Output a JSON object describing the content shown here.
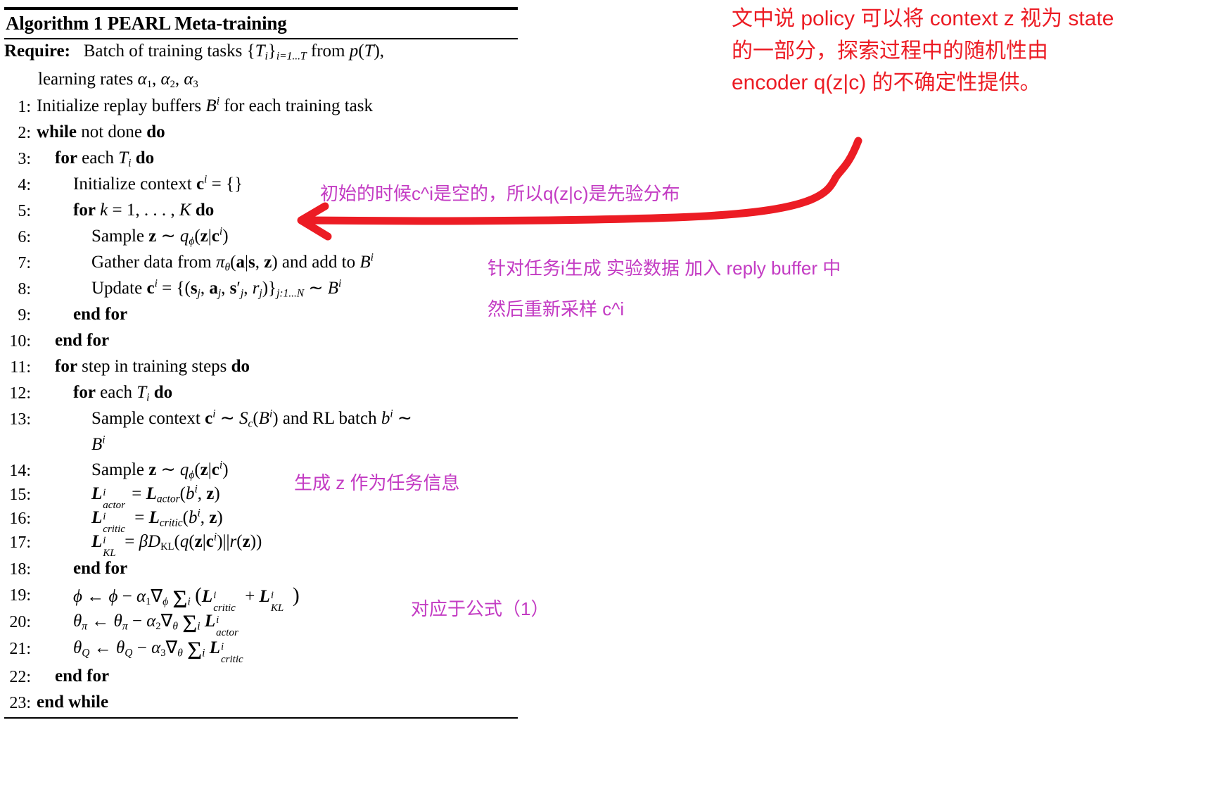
{
  "algorithm": {
    "title": "Algorithm 1 PEARL Meta-training",
    "require_label": "Require:",
    "require_line1": "Batch of training tasks {T_i}_{i=1...T} from p(T),",
    "require_line2": "learning rates α₁, α₂, α₃",
    "lines": [
      {
        "num": "1:",
        "indent": 0,
        "text": "Initialize replay buffers B^i for each training task"
      },
      {
        "num": "2:",
        "indent": 0,
        "text": "while not done do"
      },
      {
        "num": "3:",
        "indent": 1,
        "text": "for each T_i do"
      },
      {
        "num": "4:",
        "indent": 2,
        "text": "Initialize context c^i = {}"
      },
      {
        "num": "5:",
        "indent": 2,
        "text": "for k = 1, ..., K do"
      },
      {
        "num": "6:",
        "indent": 3,
        "text": "Sample z ~ q_ϕ(z|c^i)"
      },
      {
        "num": "7:",
        "indent": 3,
        "text": "Gather data from π_θ(a|s, z) and add to B^i"
      },
      {
        "num": "8:",
        "indent": 3,
        "text": "Update c^i = {(s_j, a_j, s'_j, r_j)}_{j:1...N} ~ B^i"
      },
      {
        "num": "9:",
        "indent": 2,
        "text": "end for"
      },
      {
        "num": "10:",
        "indent": 1,
        "text": "end for"
      },
      {
        "num": "11:",
        "indent": 1,
        "text": "for step in training steps do"
      },
      {
        "num": "12:",
        "indent": 2,
        "text": "for each T_i do"
      },
      {
        "num": "13:",
        "indent": 3,
        "text": "Sample context c^i ~ S_c(B^i) and RL batch b^i ~"
      },
      {
        "num": "",
        "indent": 3,
        "text": "B^i"
      },
      {
        "num": "14:",
        "indent": 3,
        "text": "Sample z ~ q_ϕ(z|c^i)"
      },
      {
        "num": "15:",
        "indent": 3,
        "text": "L^i_actor = L_actor(b^i, z)"
      },
      {
        "num": "16:",
        "indent": 3,
        "text": "L^i_critic = L_critic(b^i, z)"
      },
      {
        "num": "17:",
        "indent": 3,
        "text": "L^i_KL = β D_KL(q(z|c^i)||r(z))"
      },
      {
        "num": "18:",
        "indent": 2,
        "text": "end for"
      },
      {
        "num": "19:",
        "indent": 2,
        "text": "ϕ ← ϕ − α₁ ∇_ϕ Σ_i (L^i_critic + L^i_KL)"
      },
      {
        "num": "20:",
        "indent": 2,
        "text": "θ_π ← θ_π − α₂ ∇_θ Σ_i L^i_actor"
      },
      {
        "num": "21:",
        "indent": 2,
        "text": "θ_Q ← θ_Q − α₃ ∇_θ Σ_i L^i_critic"
      },
      {
        "num": "22:",
        "indent": 1,
        "text": "end for"
      },
      {
        "num": "23:",
        "indent": 0,
        "text": "end while"
      }
    ]
  },
  "annotations": {
    "red_top": "文中说 policy 可以将 context z 视为 state 的一部分，探索过程中的随机性由 encoder q(z|c) 的不确定性提供。",
    "line4": "初始的时候c^i是空的，所以q(z|c)是先验分布",
    "line7": "针对任务i生成 实验数据 加入 reply buffer 中",
    "line8": "然后重新采样 c^i",
    "line14": "生成 z 作为任务信息",
    "line19": "对应于公式（1）"
  },
  "colors": {
    "red": "#ec1c24",
    "magenta": "#c33bc3",
    "text": "#000000"
  }
}
